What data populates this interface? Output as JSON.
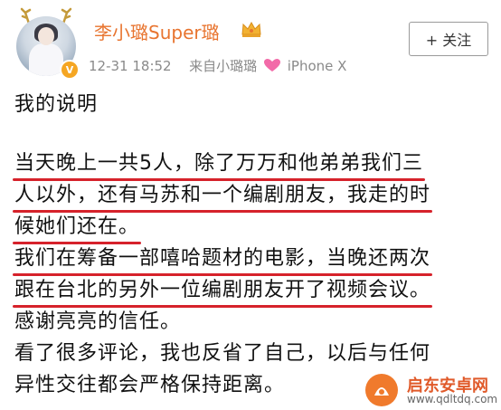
{
  "post": {
    "username": "李小璐Super璐",
    "timestamp": "12-31 18:52",
    "source_prefix": "来自小璐璐",
    "source_device": "iPhone X",
    "follow_label": "+ 关注",
    "verified_badge": "V",
    "crown_icon": "crown-icon",
    "heart_icon": "heart-icon",
    "accent_color": "#e8742f",
    "underline_color": "#d6222b"
  },
  "text": {
    "title": "我的说明",
    "l1": "当天晚上一共5人，除了万万和他弟弟我们三",
    "l2": "人以外，还有马苏和一个编剧朋友，我走的时",
    "l3": "候她们还在。",
    "l4": "我们在筹备一部嘻哈题材的电影，当晚还两次",
    "l5": "跟在台北的另外一位编剧朋友开了视频会议。",
    "l6": "感谢亮亮的信任。",
    "l7": "看了很多评论，我也反省了自己，以后与任何",
    "l8": "异性交往都会严格保持距离。"
  },
  "watermark": {
    "name": "启东安卓网",
    "url": "www.qdltdq.com"
  }
}
